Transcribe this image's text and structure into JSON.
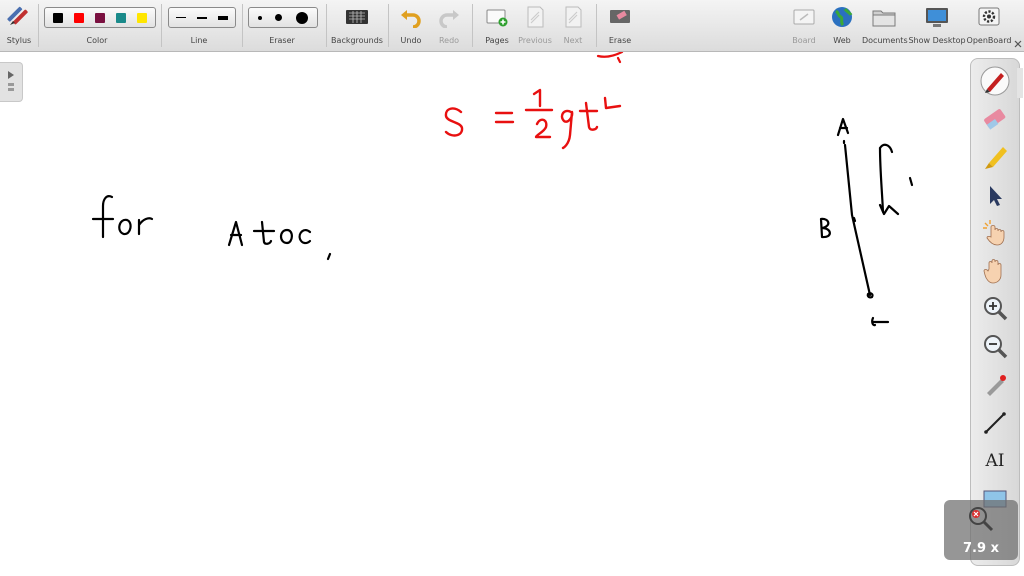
{
  "toolbar": {
    "stylus": "Stylus",
    "color": "Color",
    "line": "Line",
    "eraser": "Eraser",
    "backgrounds": "Backgrounds",
    "undo": "Undo",
    "redo": "Redo",
    "pages": "Pages",
    "previous": "Previous",
    "next": "Next",
    "erase": "Erase",
    "board": "Board",
    "web": "Web",
    "documents": "Documents",
    "show_desktop": "Show Desktop",
    "openboard": "OpenBoard"
  },
  "colors": [
    "#000000",
    "#ff0000",
    "#7a1040",
    "#1a8a8a",
    "#ffe600"
  ],
  "zoom": {
    "label": "7.9 x"
  },
  "right_tools": [
    "pen-tool-icon",
    "eraser-tool-icon",
    "marker-tool-icon",
    "selector-icon",
    "interact-icon",
    "hand-icon",
    "zoom-in-icon",
    "zoom-out-icon",
    "laser-pointer-icon",
    "line-tool-icon",
    "text-tool-icon",
    "capture-icon"
  ],
  "board": {
    "text_tool_glyph": "AI"
  }
}
